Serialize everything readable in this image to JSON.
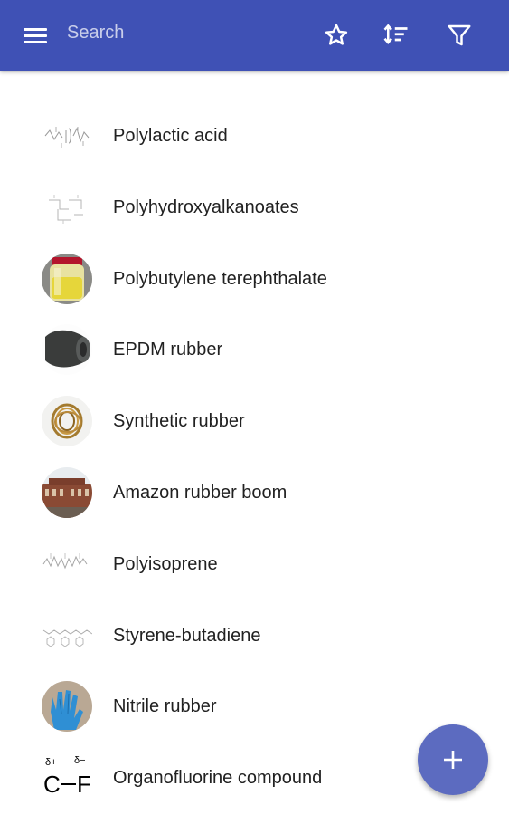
{
  "appbar": {
    "background": "#3f51b5",
    "menu_icon": "hamburger-menu-icon",
    "search_placeholder": "Search",
    "search_value": "",
    "actions": [
      "star-icon",
      "sort-icon",
      "filter-icon"
    ]
  },
  "list": {
    "items": [
      {
        "label": "Polylactic acid",
        "thumb": "structure-diagram"
      },
      {
        "label": "Polyhydroxyalkanoates",
        "thumb": "structure-diagram"
      },
      {
        "label": "Polybutylene terephthalate",
        "thumb": "yellow-jar-photo"
      },
      {
        "label": "EPDM rubber",
        "thumb": "rubber-tube-photo"
      },
      {
        "label": "Synthetic rubber",
        "thumb": "rubber-bands-photo"
      },
      {
        "label": "Amazon rubber boom",
        "thumb": "building-photo"
      },
      {
        "label": "Polyisoprene",
        "thumb": "structure-diagram"
      },
      {
        "label": "Styrene-butadiene",
        "thumb": "structure-diagram"
      },
      {
        "label": "Nitrile rubber",
        "thumb": "blue-glove-photo"
      },
      {
        "label": "Organofluorine compound",
        "thumb": "c-f-bond-diagram",
        "thumb_text": {
          "delta_plus": "δ+",
          "delta_minus": "δ−",
          "atom_left": "C",
          "atom_right": "F"
        }
      }
    ]
  },
  "fab": {
    "icon": "plus-icon",
    "color": "#5c6bc0"
  }
}
